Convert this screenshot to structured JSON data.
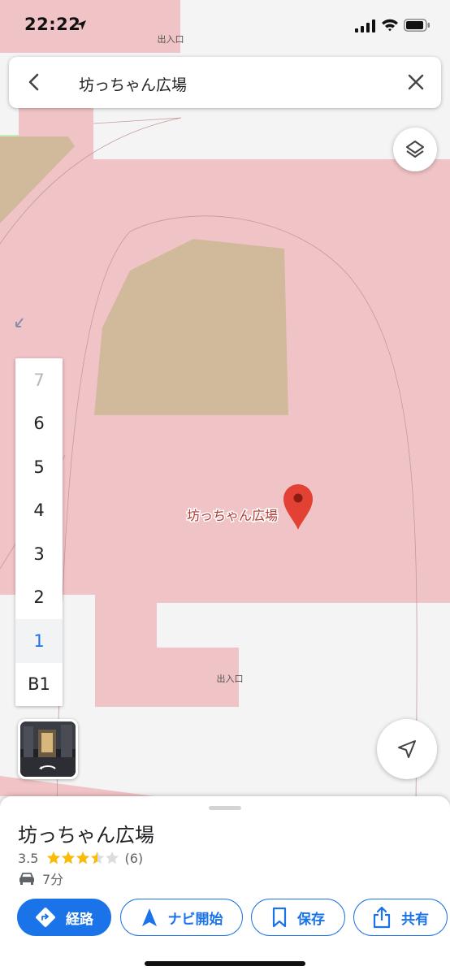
{
  "status_bar": {
    "time": "22:22"
  },
  "map": {
    "entrance_label_top": "出入口",
    "entrance_label_bottom": "出入口",
    "place_label": "坊っちゃん広場",
    "colors": {
      "shopping_area": "#f0c3c6",
      "building": "#d1b99c",
      "background": "#f4f4f4",
      "park": "#c6ebb4",
      "pin": "#e34133"
    }
  },
  "search": {
    "query": "坊っちゃん広場"
  },
  "floor_picker": {
    "floors": [
      "7",
      "6",
      "5",
      "4",
      "3",
      "2",
      "1",
      "B1"
    ],
    "selected": "1"
  },
  "place": {
    "title": "坊っちゃん広場",
    "rating": "3.5",
    "rating_value": 3.5,
    "review_count": "(6)",
    "drive_time": "7分"
  },
  "actions": {
    "directions": "経路",
    "navigate": "ナビ開始",
    "save": "保存",
    "share": "共有"
  },
  "icons": {
    "back": "back-arrow-icon",
    "clear": "close-icon",
    "layers": "layers-icon",
    "location": "location-arrow-icon",
    "car": "car-icon"
  }
}
